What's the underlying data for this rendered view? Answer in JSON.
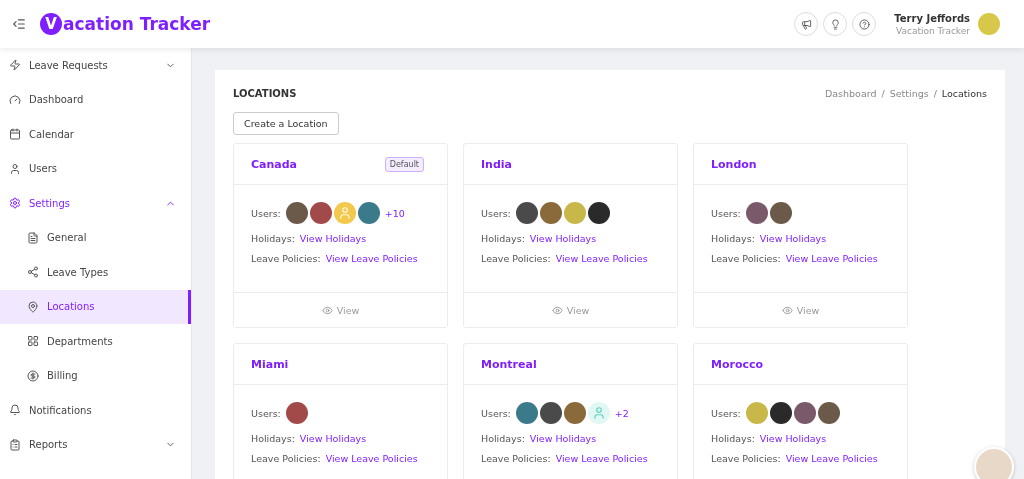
{
  "header": {
    "logo_letter": "V",
    "brand": "acation Tracker",
    "user_name": "Terry Jeffords",
    "user_org": "Vacation Tracker"
  },
  "sidebar": {
    "items": [
      {
        "label": "Leave Requests",
        "selected": false,
        "expanded": false
      },
      {
        "label": "Dashboard",
        "selected": false
      },
      {
        "label": "Calendar",
        "selected": false
      },
      {
        "label": "Users",
        "selected": false
      },
      {
        "label": "Settings",
        "selected": false,
        "expanded": true,
        "children": [
          {
            "label": "General",
            "selected": false
          },
          {
            "label": "Leave Types",
            "selected": false
          },
          {
            "label": "Locations",
            "selected": true
          },
          {
            "label": "Departments",
            "selected": false
          },
          {
            "label": "Billing",
            "selected": false
          }
        ]
      },
      {
        "label": "Notifications",
        "selected": false
      },
      {
        "label": "Reports",
        "selected": false,
        "expanded": false
      }
    ]
  },
  "page": {
    "title": "LOCATIONS",
    "breadcrumb": [
      {
        "label": "Dashboard",
        "selected": false
      },
      {
        "sep": "/",
        "label": "Settings",
        "selected": false
      },
      {
        "sep": "/",
        "label": "Locations",
        "selected": true
      }
    ],
    "create_button": "Create a Location"
  },
  "locations": [
    {
      "name": "Canada",
      "badge": "Default",
      "users_label": "Users:",
      "avatars": [
        {
          "kind": "photo"
        },
        {
          "kind": "photo"
        },
        {
          "kind": "silhouette"
        },
        {
          "kind": "photo"
        }
      ],
      "more": "+10",
      "holidays_label": "Holidays:",
      "holidays_link": "View Holidays",
      "policies_label": "Leave Policies:",
      "policies_link": "View Leave Policies",
      "view": "View"
    },
    {
      "name": "India",
      "users_label": "Users:",
      "avatars": [
        {
          "kind": "photo"
        },
        {
          "kind": "photo"
        },
        {
          "kind": "photo"
        },
        {
          "kind": "photo"
        }
      ],
      "holidays_label": "Holidays:",
      "holidays_link": "View Holidays",
      "policies_label": "Leave Policies:",
      "policies_link": "View Leave Policies",
      "view": "View"
    },
    {
      "name": "London",
      "users_label": "Users:",
      "avatars": [
        {
          "kind": "photo"
        },
        {
          "kind": "photo"
        }
      ],
      "holidays_label": "Holidays:",
      "holidays_link": "View Holidays",
      "policies_label": "Leave Policies:",
      "policies_link": "View Leave Policies",
      "view": "View"
    },
    {
      "name": "Miami",
      "users_label": "Users:",
      "avatars": [
        {
          "kind": "photo"
        }
      ],
      "holidays_label": "Holidays:",
      "holidays_link": "View Holidays",
      "policies_label": "Leave Policies:",
      "policies_link": "View Leave Policies"
    },
    {
      "name": "Montreal",
      "users_label": "Users:",
      "avatars": [
        {
          "kind": "photo"
        },
        {
          "kind": "photo"
        },
        {
          "kind": "photo"
        },
        {
          "kind": "silhouette"
        }
      ],
      "more": "+2",
      "holidays_label": "Holidays:",
      "holidays_link": "View Holidays",
      "policies_label": "Leave Policies:",
      "policies_link": "View Leave Policies"
    },
    {
      "name": "Morocco",
      "users_label": "Users:",
      "avatars": [
        {
          "kind": "photo"
        },
        {
          "kind": "photo"
        },
        {
          "kind": "photo"
        },
        {
          "kind": "photo"
        }
      ],
      "holidays_label": "Holidays:",
      "holidays_link": "View Holidays",
      "policies_label": "Leave Policies:",
      "policies_link": "View Leave Policies"
    }
  ]
}
